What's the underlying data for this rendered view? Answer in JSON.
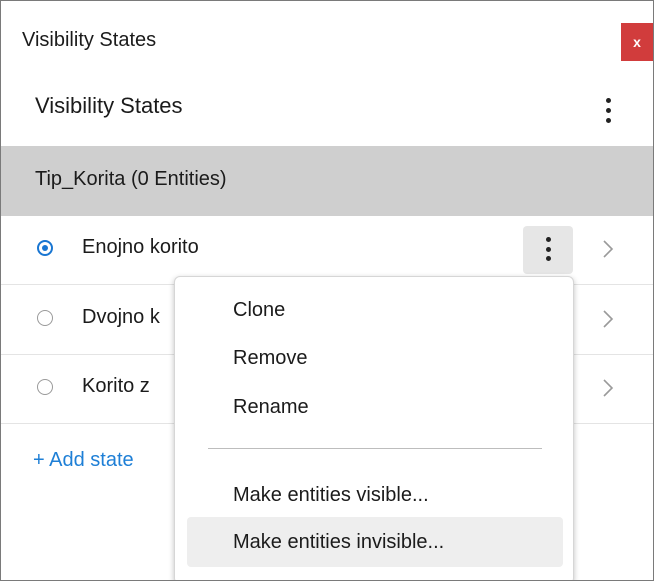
{
  "window": {
    "title": "Visibility States",
    "close_label": "x"
  },
  "panel": {
    "title": "Visibility States"
  },
  "group": {
    "label": "Tip_Korita (0 Entities)"
  },
  "states": [
    {
      "label": "Enojno korito",
      "selected": true
    },
    {
      "label": "Dvojno k",
      "selected": false
    },
    {
      "label": "Korito z",
      "selected": false
    }
  ],
  "add_state_label": "+ Add state",
  "context_menu": {
    "items": [
      "Clone",
      "Remove",
      "Rename"
    ],
    "entity_items": [
      "Make entities visible...",
      "Make entities invisible..."
    ]
  },
  "colors": {
    "accent": "#1976d2",
    "link": "#1e7fd6",
    "close": "#d13c3c",
    "group_bg": "#cfcfcf"
  },
  "icons": [
    "close-icon",
    "more-vertical-icon",
    "radio-checked-icon",
    "radio-unchecked-icon",
    "chevron-right-icon"
  ]
}
